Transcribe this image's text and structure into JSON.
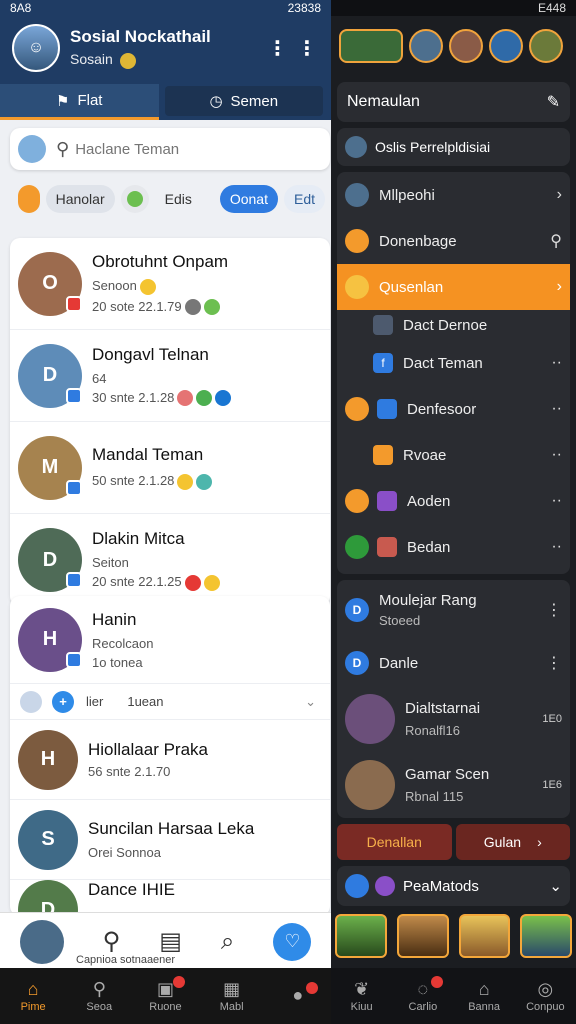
{
  "left": {
    "status": {
      "time": "8A8",
      "right": "23838"
    },
    "header": {
      "name": "Sosial Nockathail",
      "subtitle": "Sosain",
      "more_icon": "vertical-dots-icon"
    },
    "tabs": [
      {
        "label": "Flat"
      },
      {
        "label": "Semen"
      }
    ],
    "search": {
      "placeholder": "Haclane Teman"
    },
    "chips": [
      {
        "label": "Hanolar"
      },
      {
        "label": "Edis"
      },
      {
        "label": "Oonat"
      },
      {
        "label": "Edt"
      }
    ],
    "list1": [
      {
        "name": "Obrotuhnt Onpam",
        "status": "Senoon",
        "time": "20 sote 22.1.79",
        "color": "#9c6b4e"
      },
      {
        "name": "Dongavl Telnan",
        "status": "64",
        "time": "30 snte 2.1.28",
        "color": "#5e8cb8"
      },
      {
        "name": "Mandal Teman",
        "status": "",
        "time": "50 snte 2.1.28",
        "color": "#a6834f"
      },
      {
        "name": "Dlakin Mitca",
        "status": "Seiton",
        "time": "20 snte 22.1.25",
        "color": "#4f6b57"
      }
    ],
    "list2": [
      {
        "name": "Hanin",
        "status": "Recolcaon",
        "time": "1o tonea",
        "color": "#6a4f8a"
      },
      {
        "name": "Hiollalaar Praka",
        "status": "",
        "time": "56 snte 2.1.70",
        "color": "#7c5b3f"
      },
      {
        "name": "Suncilan Harsaa Leka",
        "status": "Orei Sonnoa",
        "time": "",
        "color": "#3f6a87"
      },
      {
        "name": "Dance IHIE",
        "status": "",
        "time": "",
        "color": "#537b4a"
      }
    ],
    "subrow": {
      "label": "lier",
      "extra": "1uean"
    },
    "quick": {
      "caption": "Capnioa sotnaaener"
    },
    "nav": [
      {
        "label": "Pime",
        "icon": "home-icon"
      },
      {
        "label": "Seoa",
        "icon": "search-icon"
      },
      {
        "label": "Ruone",
        "icon": "chat-icon"
      },
      {
        "label": "Mabl",
        "icon": "grid-icon"
      },
      {
        "label": "",
        "icon": "person-icon"
      }
    ]
  },
  "right": {
    "status": {
      "right": "E448"
    },
    "title": "Nemaulan",
    "search_row": "Oslis Perrelpldisiai",
    "items": [
      {
        "label": "Mllpeohi",
        "end": ">"
      },
      {
        "label": "Donenbage",
        "end": "search"
      },
      {
        "label": "Qusenlan",
        "end": ">",
        "highlight": true
      },
      {
        "label": "Dact Dernoe",
        "end": ""
      },
      {
        "label": "Dact Teman",
        "end": "..."
      },
      {
        "label": "Denfesoor",
        "end": "..."
      },
      {
        "label": "Rvoae",
        "end": "..."
      },
      {
        "label": "Aoden",
        "end": "..."
      },
      {
        "label": "Bedan",
        "end": "..."
      }
    ],
    "people": [
      {
        "name": "Moulejar Rang",
        "status": "Stoeed",
        "end": ""
      },
      {
        "name": "Danle",
        "status": "",
        "end": ""
      },
      {
        "name": "Dialtstarnai",
        "status": "Ronalfl16",
        "end": "1E0"
      },
      {
        "name": "Gamar Scen",
        "status": "Rbnal 115",
        "end": "1E6"
      }
    ],
    "buttons": [
      {
        "label": "Denallan"
      },
      {
        "label": "Gulan"
      }
    ],
    "folder": {
      "label": "PeaMatods"
    },
    "nav": [
      {
        "label": "Kiuu"
      },
      {
        "label": "Carlio"
      },
      {
        "label": "Banna"
      },
      {
        "label": "Conpuo"
      }
    ]
  }
}
